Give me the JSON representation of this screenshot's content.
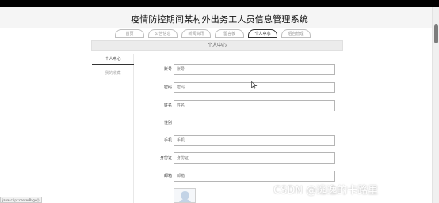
{
  "site": {
    "title": "疫情防控期间某村外出务工人员信息管理系统"
  },
  "nav": {
    "items": [
      {
        "label": "首页",
        "active": false
      },
      {
        "label": "公告信息",
        "active": false
      },
      {
        "label": "新闻资讯",
        "active": false
      },
      {
        "label": "留言板",
        "active": false
      },
      {
        "label": "个人中心",
        "active": true
      },
      {
        "label": "后台管理",
        "active": false
      }
    ]
  },
  "page": {
    "heading": "个人中心"
  },
  "sidebar": {
    "items": [
      {
        "label": "个人中心",
        "active": true
      },
      {
        "label": "我的收藏",
        "active": false
      }
    ]
  },
  "form": {
    "account": {
      "label": "账号",
      "placeholder": "账号"
    },
    "password": {
      "label": "密码",
      "placeholder": "密码"
    },
    "name": {
      "label": "姓名",
      "placeholder": "姓名"
    },
    "gender": {
      "label": "性别"
    },
    "phone": {
      "label": "手机",
      "placeholder": "手机"
    },
    "id_card": {
      "label": "身份证",
      "placeholder": "身份证"
    },
    "email": {
      "label": "邮箱",
      "placeholder": "邮箱"
    }
  },
  "status_bar": {
    "url": "javascript:centerPage()"
  },
  "watermark": {
    "text": "CSDN @逃逸的卡路里"
  }
}
